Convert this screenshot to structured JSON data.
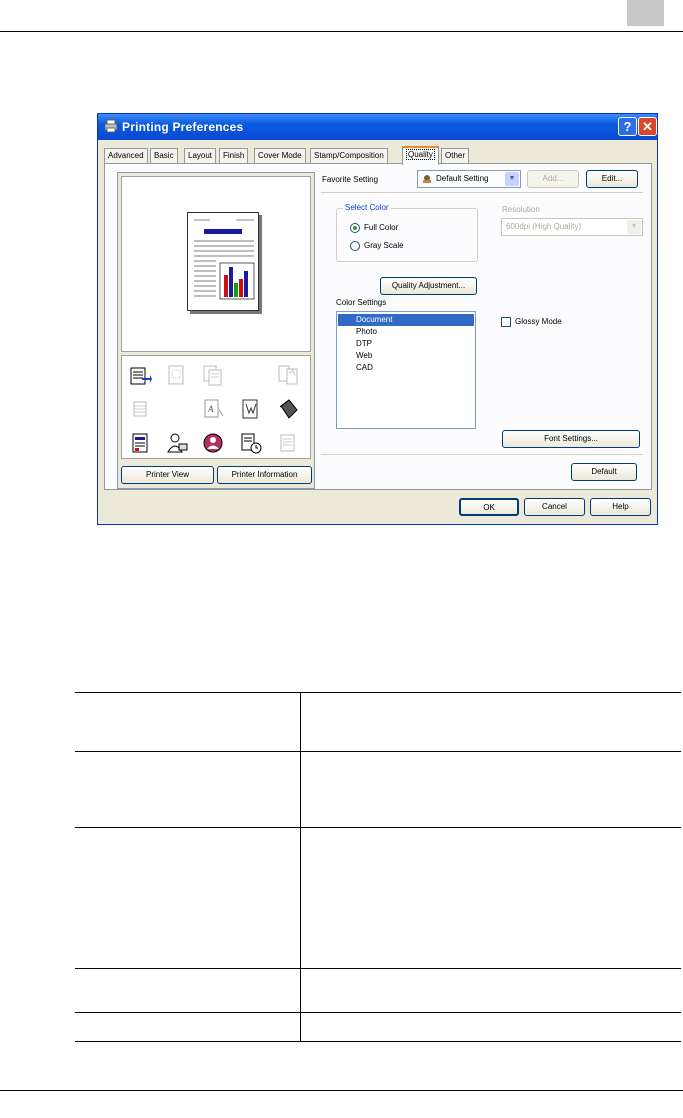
{
  "dialog": {
    "title": "Printing Preferences",
    "help_glyph": "?",
    "close_glyph": "✕",
    "tabs": [
      {
        "label": "Advanced"
      },
      {
        "label": "Basic"
      },
      {
        "label": "Layout"
      },
      {
        "label": "Finish"
      },
      {
        "label": "Cover Mode"
      },
      {
        "label": "Stamp/Composition"
      },
      {
        "label": "Quality",
        "active": true
      },
      {
        "label": "Other"
      }
    ],
    "favorite": {
      "label": "Favorite Setting",
      "value": "Default Setting",
      "add_label": "Add...",
      "edit_label": "Edit..."
    },
    "select_color": {
      "title": "Select Color",
      "options": [
        "Full Color",
        "Gray Scale"
      ],
      "selected": "Full Color"
    },
    "quality_adjustment_label": "Quality Adjustment...",
    "resolution": {
      "label": "Resolution",
      "value": "600dpi (High Quality)"
    },
    "color_settings": {
      "label": "Color Settings",
      "items": [
        "Document",
        "Photo",
        "DTP",
        "Web",
        "CAD"
      ],
      "selected": "Document"
    },
    "glossy_mode_label": "Glossy Mode",
    "font_settings_label": "Font Settings...",
    "default_label": "Default",
    "printer_view_label": "Printer View",
    "printer_information_label": "Printer Information",
    "ok_label": "OK",
    "cancel_label": "Cancel",
    "help_label": "Help"
  },
  "colors": {
    "title_bar": "#0a5ae0",
    "dialog_bg": "#ece9d8",
    "selection": "#316ac5",
    "active_tab_accent": "#e68b2c"
  }
}
